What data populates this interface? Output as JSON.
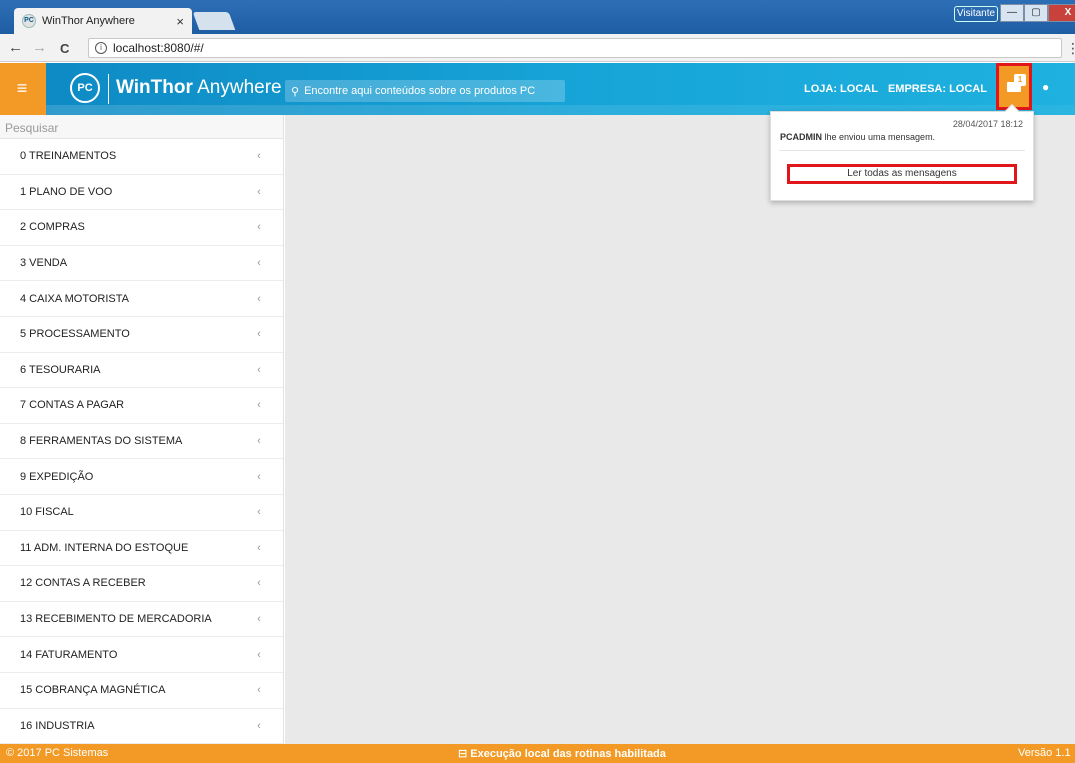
{
  "browser": {
    "tab_title": "WinThor Anywhere",
    "tab_close": "×",
    "url": "localhost:8080/#/",
    "user_label": "Visitante",
    "back": "←",
    "forward": "→",
    "reload": "C",
    "info": "i",
    "menu": "⋮",
    "win_min": "—",
    "win_max": "▢",
    "win_close": "X"
  },
  "header": {
    "brand_bold": "WinThor",
    "brand_light": " Anywhere",
    "logo_text": "PC",
    "search_placeholder": "Encontre aqui conteúdos sobre os produtos PC",
    "loja": "LOJA: LOCAL",
    "empresa": "EMPRESA: LOCAL",
    "message_count": "1",
    "hamburger": "≡",
    "search_icon": "⚲",
    "user_icon": "●"
  },
  "sidebar": {
    "search_placeholder": "Pesquisar",
    "chevron": "‹",
    "items": [
      {
        "label": "0  TREINAMENTOS"
      },
      {
        "label": "1  PLANO DE VOO"
      },
      {
        "label": "2  COMPRAS"
      },
      {
        "label": "3  VENDA"
      },
      {
        "label": "4  CAIXA MOTORISTA"
      },
      {
        "label": "5  PROCESSAMENTO"
      },
      {
        "label": "6  TESOURARIA"
      },
      {
        "label": "7  CONTAS A PAGAR"
      },
      {
        "label": "8  FERRAMENTAS DO SISTEMA"
      },
      {
        "label": "9  EXPEDIÇÃO"
      },
      {
        "label": "10  FISCAL"
      },
      {
        "label": "11  ADM. INTERNA DO ESTOQUE"
      },
      {
        "label": "12  CONTAS A RECEBER"
      },
      {
        "label": "13  RECEBIMENTO DE MERCADORIA"
      },
      {
        "label": "14  FATURAMENTO"
      },
      {
        "label": "15  COBRANÇA MAGNÉTICA"
      },
      {
        "label": "16  INDUSTRIA"
      }
    ]
  },
  "messages": {
    "date": "28/04/2017 18:12",
    "sender": "PCADMIN",
    "text": " lhe enviou uma mensagem.",
    "read_all": "Ler todas as mensagens"
  },
  "footer": {
    "copyright": "© 2017 PC Sistemas",
    "status": "⊟  Execução local das rotinas habilitada",
    "version": "Versão 1.1"
  }
}
